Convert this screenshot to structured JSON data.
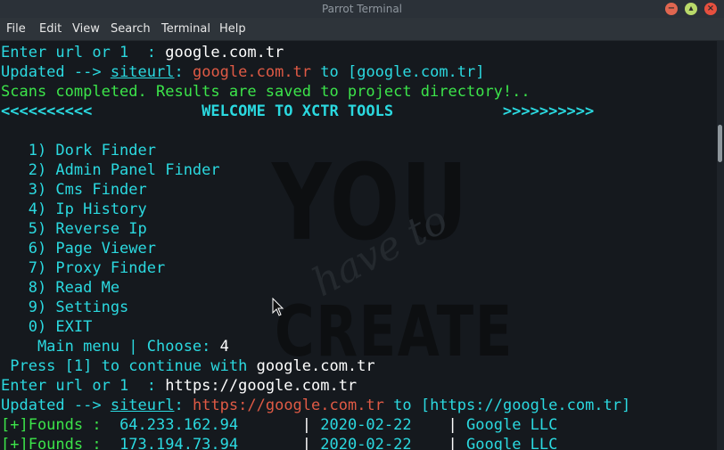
{
  "window": {
    "title": "Parrot Terminal",
    "controls": {
      "minimize": "−",
      "maximize": "▴",
      "close": "×"
    }
  },
  "menu": [
    "File",
    "Edit",
    "View",
    "Search",
    "Terminal",
    "Help"
  ],
  "watermark": {
    "line1": "YOU",
    "script": "have to",
    "line2": "CREATE"
  },
  "lines": [
    {
      "segs": [
        {
          "t": "Enter url or 1  : ",
          "c": "cyan"
        },
        {
          "t": "google.com.tr",
          "c": "white"
        }
      ]
    },
    {
      "segs": [
        {
          "t": "Updated --> ",
          "c": "cyan"
        },
        {
          "t": "siteurl",
          "c": "cyan",
          "u": true
        },
        {
          "t": ": ",
          "c": "cyan"
        },
        {
          "t": "google.com.tr",
          "c": "red"
        },
        {
          "t": " to [google.com.tr]",
          "c": "cyan"
        }
      ]
    },
    {
      "segs": [
        {
          "t": "Scans completed. Results are saved to project directory!..",
          "c": "green"
        }
      ]
    },
    {
      "segs": [
        {
          "t": "<<<<<<<<<<            WELCOME TO XCTR TOOLS            >>>>>>>>>>",
          "c": "cyan",
          "b": true
        }
      ]
    },
    {
      "segs": [
        {
          "t": " ",
          "c": "cyan"
        }
      ]
    },
    {
      "segs": [
        {
          "t": "   1) Dork Finder",
          "c": "cyan"
        }
      ]
    },
    {
      "segs": [
        {
          "t": "   2) Admin Panel Finder",
          "c": "cyan"
        }
      ]
    },
    {
      "segs": [
        {
          "t": "   3) Cms Finder",
          "c": "cyan"
        }
      ]
    },
    {
      "segs": [
        {
          "t": "   4) Ip History",
          "c": "cyan"
        }
      ]
    },
    {
      "segs": [
        {
          "t": "   5) Reverse Ip",
          "c": "cyan"
        }
      ]
    },
    {
      "segs": [
        {
          "t": "   6) Page Viewer",
          "c": "cyan"
        }
      ]
    },
    {
      "segs": [
        {
          "t": "   7) Proxy Finder",
          "c": "cyan"
        }
      ]
    },
    {
      "segs": [
        {
          "t": "   8) Read Me",
          "c": "cyan"
        }
      ]
    },
    {
      "segs": [
        {
          "t": "   9) Settings",
          "c": "cyan"
        }
      ]
    },
    {
      "segs": [
        {
          "t": "   0) EXIT",
          "c": "cyan"
        }
      ]
    },
    {
      "segs": [
        {
          "t": "    Main menu | Choose: ",
          "c": "cyan"
        },
        {
          "t": "4",
          "c": "white"
        }
      ]
    },
    {
      "segs": [
        {
          "t": " Press [1] to continue with ",
          "c": "cyan"
        },
        {
          "t": "google.com.tr",
          "c": "white"
        }
      ]
    },
    {
      "segs": [
        {
          "t": "Enter url or 1  : ",
          "c": "cyan"
        },
        {
          "t": "https://google.com.tr",
          "c": "white"
        }
      ]
    },
    {
      "segs": [
        {
          "t": "Updated --> ",
          "c": "cyan"
        },
        {
          "t": "siteurl",
          "c": "cyan",
          "u": true
        },
        {
          "t": ": ",
          "c": "cyan"
        },
        {
          "t": "https://google.com.tr",
          "c": "red"
        },
        {
          "t": " to [https://google.com.tr]",
          "c": "cyan"
        }
      ]
    },
    {
      "segs": [
        {
          "t": "[+]Founds :  ",
          "c": "green"
        },
        {
          "t": "64.233.162.94",
          "c": "cyan"
        },
        {
          "t": "       | ",
          "c": "white"
        },
        {
          "t": "2020-02-22",
          "c": "cyan"
        },
        {
          "t": "    | ",
          "c": "white"
        },
        {
          "t": "Google LLC",
          "c": "cyan"
        }
      ]
    },
    {
      "segs": [
        {
          "t": "[+]Founds :  ",
          "c": "green"
        },
        {
          "t": "173.194.73.94",
          "c": "cyan"
        },
        {
          "t": "       | ",
          "c": "white"
        },
        {
          "t": "2020-02-22",
          "c": "cyan"
        },
        {
          "t": "    | ",
          "c": "white"
        },
        {
          "t": "Google LLC",
          "c": "cyan"
        }
      ]
    }
  ]
}
